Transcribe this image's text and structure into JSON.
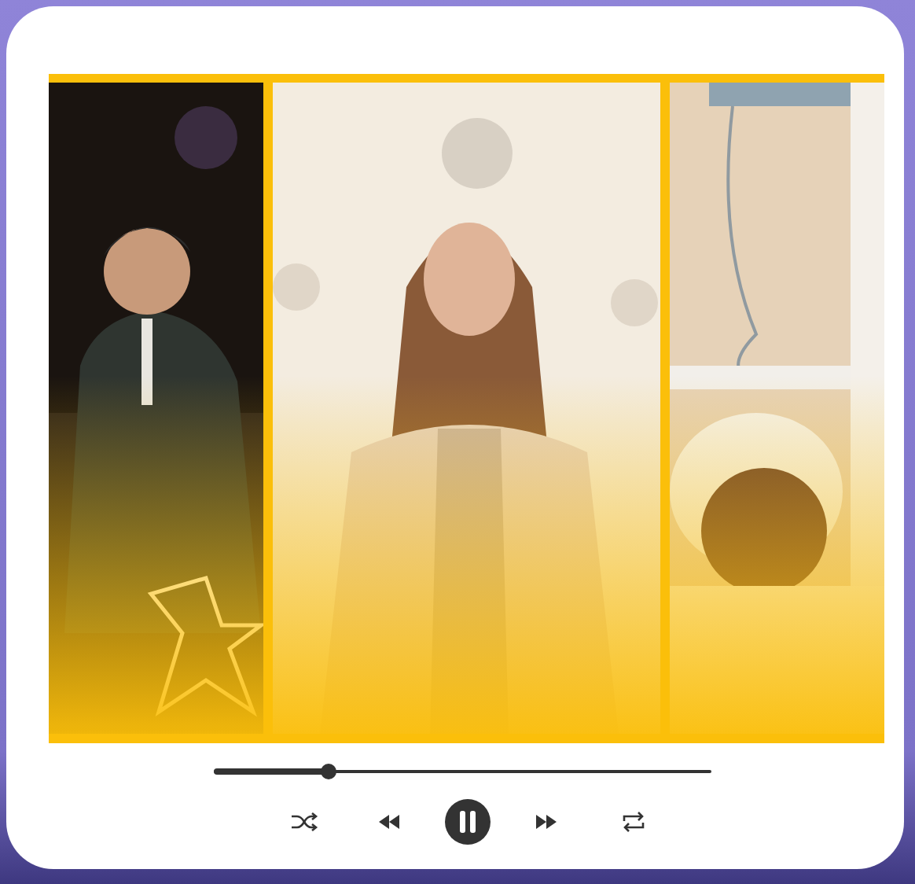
{
  "player": {
    "progress": {
      "level": 0.23
    },
    "playing": true
  }
}
